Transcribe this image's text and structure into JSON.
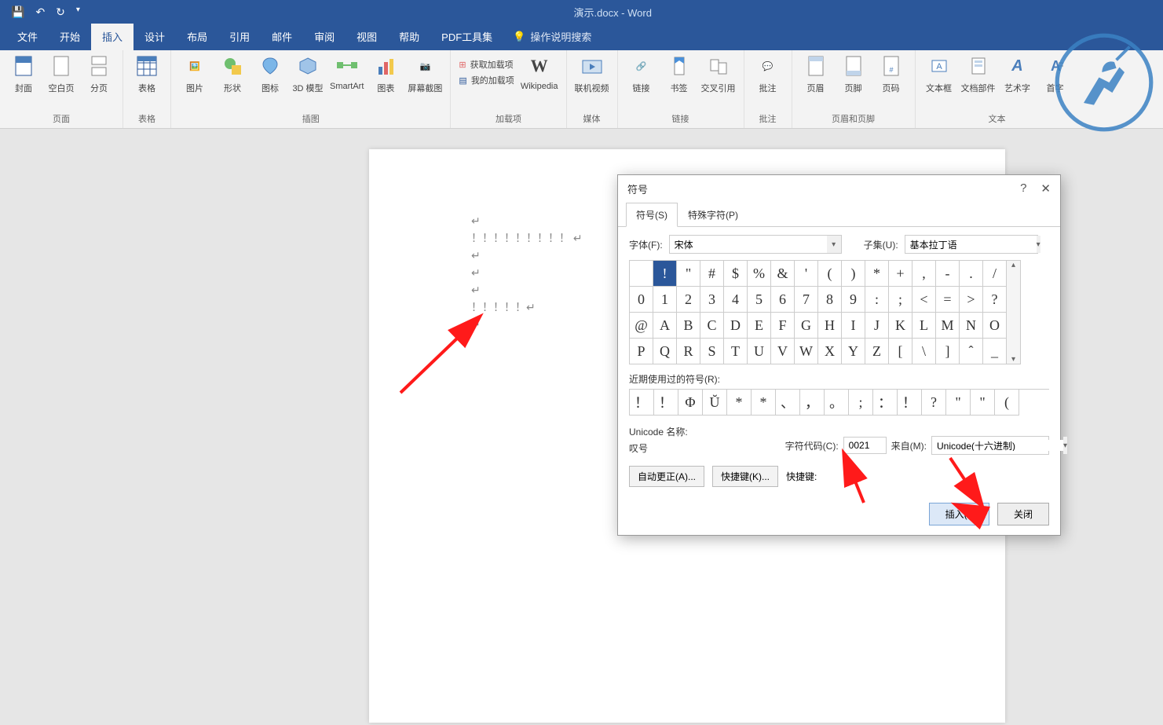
{
  "app": {
    "title": "演示.docx - Word"
  },
  "tabs": [
    "文件",
    "开始",
    "插入",
    "设计",
    "布局",
    "引用",
    "邮件",
    "审阅",
    "视图",
    "帮助",
    "PDF工具集"
  ],
  "active_tab": 2,
  "search_hint": "操作说明搜索",
  "ribbon_groups": {
    "page": {
      "items": [
        "封面",
        "空白页",
        "分页"
      ],
      "label": "页面"
    },
    "table": {
      "items": [
        "表格"
      ],
      "label": "表格"
    },
    "illus": {
      "items": [
        "图片",
        "形状",
        "图标",
        "3D 模型",
        "SmartArt",
        "图表",
        "屏幕截图"
      ],
      "label": "插图"
    },
    "addins": {
      "get": "获取加载项",
      "my": "我的加载项",
      "wiki": "Wikipedia",
      "label": "加载项"
    },
    "media": {
      "items": [
        "联机视频"
      ],
      "label": "媒体"
    },
    "links": {
      "items": [
        "链接",
        "书签",
        "交叉引用"
      ],
      "label": "链接"
    },
    "comments": {
      "items": [
        "批注"
      ],
      "label": "批注"
    },
    "hf": {
      "items": [
        "页眉",
        "页脚",
        "页码"
      ],
      "label": "页眉和页脚"
    },
    "text": {
      "items": [
        "文本框",
        "文档部件",
        "艺术字",
        "首字"
      ],
      "label": "文本"
    }
  },
  "doc_lines": [
    "↵",
    "！！！！！！！！！  ↵",
    "↵",
    "↵",
    "↵",
    "！！！！！↵",
    "↵"
  ],
  "dialog": {
    "title": "符号",
    "tabs": [
      "符号(S)",
      "特殊字符(P)"
    ],
    "font_label": "字体(F):",
    "font_value": "宋体",
    "subset_label": "子集(U):",
    "subset_value": "基本拉丁语",
    "grid": [
      [
        " ",
        "!",
        "\"",
        "#",
        "$",
        "%",
        "&",
        "'",
        "(",
        ")",
        "*",
        "+",
        ",",
        "-",
        ".",
        "/"
      ],
      [
        "0",
        "1",
        "2",
        "3",
        "4",
        "5",
        "6",
        "7",
        "8",
        "9",
        ":",
        ";",
        "<",
        "=",
        ">",
        "?"
      ],
      [
        "@",
        "A",
        "B",
        "C",
        "D",
        "E",
        "F",
        "G",
        "H",
        "I",
        "J",
        "K",
        "L",
        "M",
        "N",
        "O"
      ],
      [
        "P",
        "Q",
        "R",
        "S",
        "T",
        "U",
        "V",
        "W",
        "X",
        "Y",
        "Z",
        "[",
        "\\",
        "]",
        "ˆ",
        "_"
      ]
    ],
    "selected_cell": "!",
    "recent_label": "近期使用过的符号(R):",
    "recent": [
      "！",
      "！",
      "Φ",
      "Ŭ",
      "*",
      "*",
      "、",
      "，",
      "。",
      ";",
      "：",
      "！",
      "?",
      "\"",
      "\"",
      "("
    ],
    "unicode_name_label": "Unicode 名称:",
    "unicode_name": "叹号",
    "charcode_label": "字符代码(C):",
    "charcode_value": "0021",
    "from_label": "来自(M):",
    "from_value": "Unicode(十六进制)",
    "autocorrect": "自动更正(A)...",
    "shortcut_btn": "快捷键(K)...",
    "shortcut_label": "快捷键:",
    "insert": "插入(I)",
    "close": "关闭"
  },
  "colors": {
    "accent": "#2b579a"
  }
}
